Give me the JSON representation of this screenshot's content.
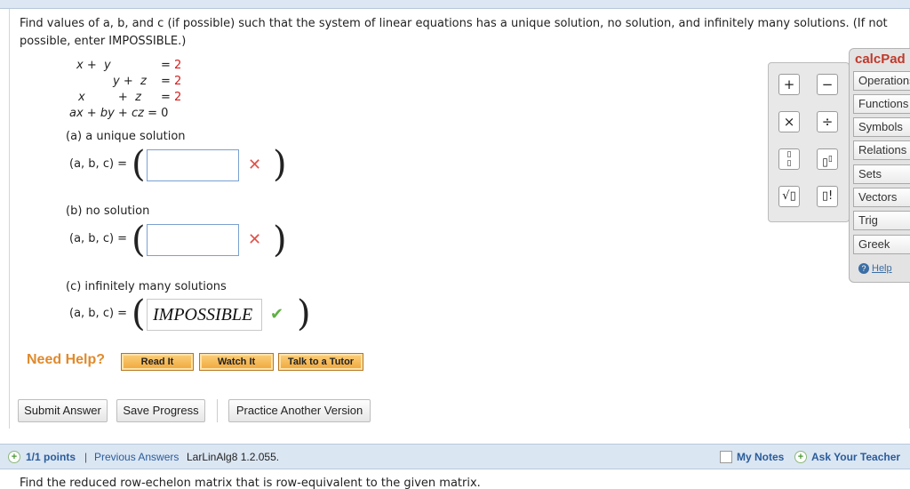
{
  "question": {
    "prompt": "Find values of a, b, and c (if possible) such that the system of linear equations has a unique solution, no solution, and infinitely many solutions. (If not possible, enter IMPOSSIBLE.)",
    "rhs": [
      "2",
      "2",
      "2",
      "0"
    ],
    "parts": [
      {
        "label": "(a) a unique solution",
        "tuple_label": "(a, b, c) =",
        "value": "",
        "status": "incorrect"
      },
      {
        "label": "(b) no solution",
        "tuple_label": "(a, b, c) =",
        "value": "",
        "status": "incorrect"
      },
      {
        "label": "(c) infinitely many solutions",
        "tuple_label": "(a, b, c) =",
        "value": "IMPOSSIBLE",
        "status": "correct"
      }
    ]
  },
  "help": {
    "title": "Need Help?",
    "buttons": [
      "Read It",
      "Watch It",
      "Talk to a Tutor"
    ]
  },
  "actions": {
    "submit": "Submit Answer",
    "save": "Save Progress",
    "practice": "Practice Another Version"
  },
  "calcpad": {
    "title": "calcPad",
    "tabs": [
      "Operations",
      "Functions",
      "Symbols",
      "Relations",
      "Sets",
      "Vectors",
      "Trig",
      "Greek"
    ],
    "help": "Help",
    "buttons": [
      "plus-icon",
      "minus-icon",
      "times-icon",
      "divide-icon",
      "fraction-icon",
      "exponent-icon",
      "sqrt-icon",
      "factorial-icon"
    ]
  },
  "next_question": {
    "points": "1/1 points",
    "previous": "Previous Answers",
    "code": "LarLinAlg8 1.2.055.",
    "my_notes": "My Notes",
    "ask_teacher": "Ask Your Teacher",
    "prompt": "Find the reduced row-echelon matrix that is row-equivalent to the given matrix."
  },
  "colors": {
    "rhs": "#d12020",
    "need_help": "#e08a2c",
    "incorrect": "#e0524a",
    "correct": "#5fb044",
    "link": "#3a6ea5",
    "calcpad_title": "#c0392b"
  }
}
